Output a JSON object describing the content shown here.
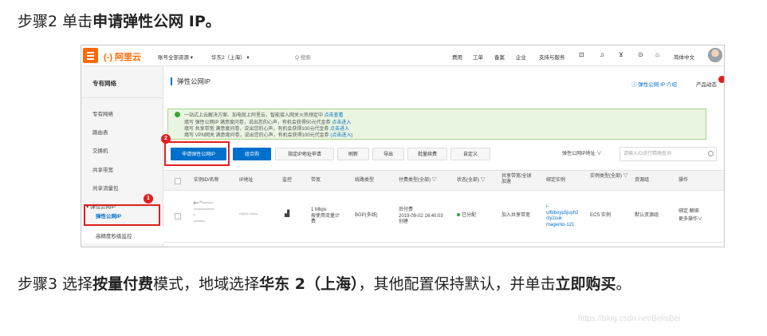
{
  "step2": {
    "prefix": "步骤2  单击",
    "bold": "申请弹性公网",
    "suffix": " IP。"
  },
  "step3": {
    "prefix": "步骤3  选择",
    "bold1": "按量付费",
    "mid1": "模式，地域选择",
    "bold2": "华东 2（上海）",
    "mid2": "，其他配置保持默认，并单击",
    "bold3": "立即购买",
    "suffix": "。"
  },
  "console": {
    "logo": "(-) 阿里云",
    "topbar": {
      "account": "账号全部资源 ▾",
      "region": "华东2（上海） ▾",
      "search": "Q  搜索",
      "links": [
        "费用",
        "工单",
        "备案",
        "企业",
        "支持与服务"
      ],
      "lang": "简体中文"
    },
    "sidebar": {
      "title": "专有网络",
      "items": [
        "专有网络",
        "路由表",
        "交换机",
        "共享带宽",
        "共享流量包",
        "▾ 弹性公网IP"
      ],
      "active": "弹性公网IP",
      "after": "高精度秒级监控"
    },
    "main": {
      "title": "弹性公网IP",
      "help": "ⓘ 弹性公网 IP 介绍",
      "product_dynamic": "产品动态"
    },
    "notice": {
      "lines": [
        {
          "text": "一站式上云解决方案、加电就上阿里云，智能接入网关火热预定中 ",
          "link": "点击查看"
        },
        {
          "text": "填写 弹性公网IP 满意度问卷，说出您的心声，有机会获得50元代金券 ",
          "link": "点击进入"
        },
        {
          "text": "填写 共享带宽 满意度问卷，说出您的心声，有机会获得100元代金券 ",
          "link": "点击进入"
        },
        {
          "text": "填写 VPN网关 满意度问卷，说出您的心声，有机会获得100元代金券 ",
          "link": "(点击进入)"
        }
      ]
    },
    "toolbar": {
      "apply": "申请弹性公网IP",
      "bundle": "组合购",
      "specified": "指定IP地址申请",
      "refresh": "刷新",
      "export": "导出",
      "renew": "批量续费",
      "custom": "自定义",
      "filter": "弹性公网IP地址 ∨",
      "search_placeholder": "请输入ID进行精确查询"
    },
    "table": {
      "headers": [
        "实例ID/名称",
        "IP地址",
        "监控",
        "带宽",
        "线路类型",
        "付费类型(全部) ▽",
        "状态(全部) ▽",
        "共享带宽/全球加速",
        "绑定实例",
        "实例类型(全部) ▽",
        "资源组",
        "操作"
      ],
      "row": {
        "id": "i-··\"·······\n·············\n·\n·······",
        "ip": "··:··· ·····",
        "bandwidth": "1 Mbps\n按使用流量计\n费",
        "line": "BGP(多线)",
        "pay": "后付费\n2019-09-02 16:40:03\n创建",
        "status": "已分配",
        "share": "加入共享带宽",
        "bound": "i-\nuf6iboyp5juyh2\ncly2suk\nmagento-121",
        "type": "ECS 实例",
        "group": "默认资源组",
        "ops1": "绑定  解绑",
        "ops2": "更多操作∨"
      }
    },
    "badges": {
      "one": "1",
      "two": "2"
    }
  },
  "watermark": "https://blog.csdn.net/BelisBei",
  "colors": {
    "brand": "#ff6a00",
    "primary": "#0070cc",
    "highlight": "#e02020"
  }
}
